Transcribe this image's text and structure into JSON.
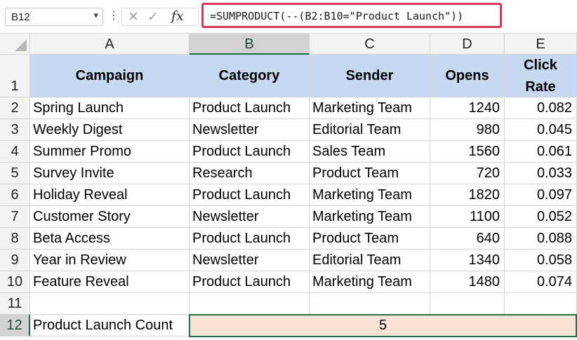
{
  "formula_bar": {
    "name_box": "B12",
    "cancel_icon": "✕",
    "enter_icon": "✓",
    "fx_label": "fx",
    "formula": "=SUMPRODUCT(--(B2:B10=\"Product Launch\"))"
  },
  "columns": [
    "A",
    "B",
    "C",
    "D",
    "E"
  ],
  "selected_column": "B",
  "rows": [
    "1",
    "2",
    "3",
    "4",
    "5",
    "6",
    "7",
    "8",
    "9",
    "10",
    "11",
    "12"
  ],
  "selected_row": "12",
  "header": {
    "campaign": "Campaign",
    "category": "Category",
    "sender": "Sender",
    "opens": "Opens",
    "click_rate_line1": "Click",
    "click_rate_line2": "Rate"
  },
  "data_rows": [
    {
      "campaign": "Spring Launch",
      "category": "Product Launch",
      "sender": "Marketing Team",
      "opens": "1240",
      "click_rate": "0.082"
    },
    {
      "campaign": "Weekly Digest",
      "category": "Newsletter",
      "sender": "Editorial Team",
      "opens": "980",
      "click_rate": "0.045"
    },
    {
      "campaign": "Summer Promo",
      "category": "Product Launch",
      "sender": "Sales Team",
      "opens": "1560",
      "click_rate": "0.061"
    },
    {
      "campaign": "Survey Invite",
      "category": "Research",
      "sender": "Product Team",
      "opens": "720",
      "click_rate": "0.033"
    },
    {
      "campaign": "Holiday Reveal",
      "category": "Product Launch",
      "sender": "Marketing Team",
      "opens": "1820",
      "click_rate": "0.097"
    },
    {
      "campaign": "Customer Story",
      "category": "Newsletter",
      "sender": "Marketing Team",
      "opens": "1100",
      "click_rate": "0.052"
    },
    {
      "campaign": "Beta Access",
      "category": "Product Launch",
      "sender": "Product Team",
      "opens": "640",
      "click_rate": "0.088"
    },
    {
      "campaign": "Year in Review",
      "category": "Newsletter",
      "sender": "Editorial Team",
      "opens": "1340",
      "click_rate": "0.058"
    },
    {
      "campaign": "Feature Reveal",
      "category": "Product Launch",
      "sender": "Marketing Team",
      "opens": "1480",
      "click_rate": "0.074"
    }
  ],
  "summary": {
    "label": "Product Launch Count",
    "value": "5"
  },
  "colors": {
    "header_fill": "#c6d9f0",
    "result_fill": "#fbe4d5",
    "selection": "#1e7145",
    "formula_highlight": "#d6375a"
  }
}
